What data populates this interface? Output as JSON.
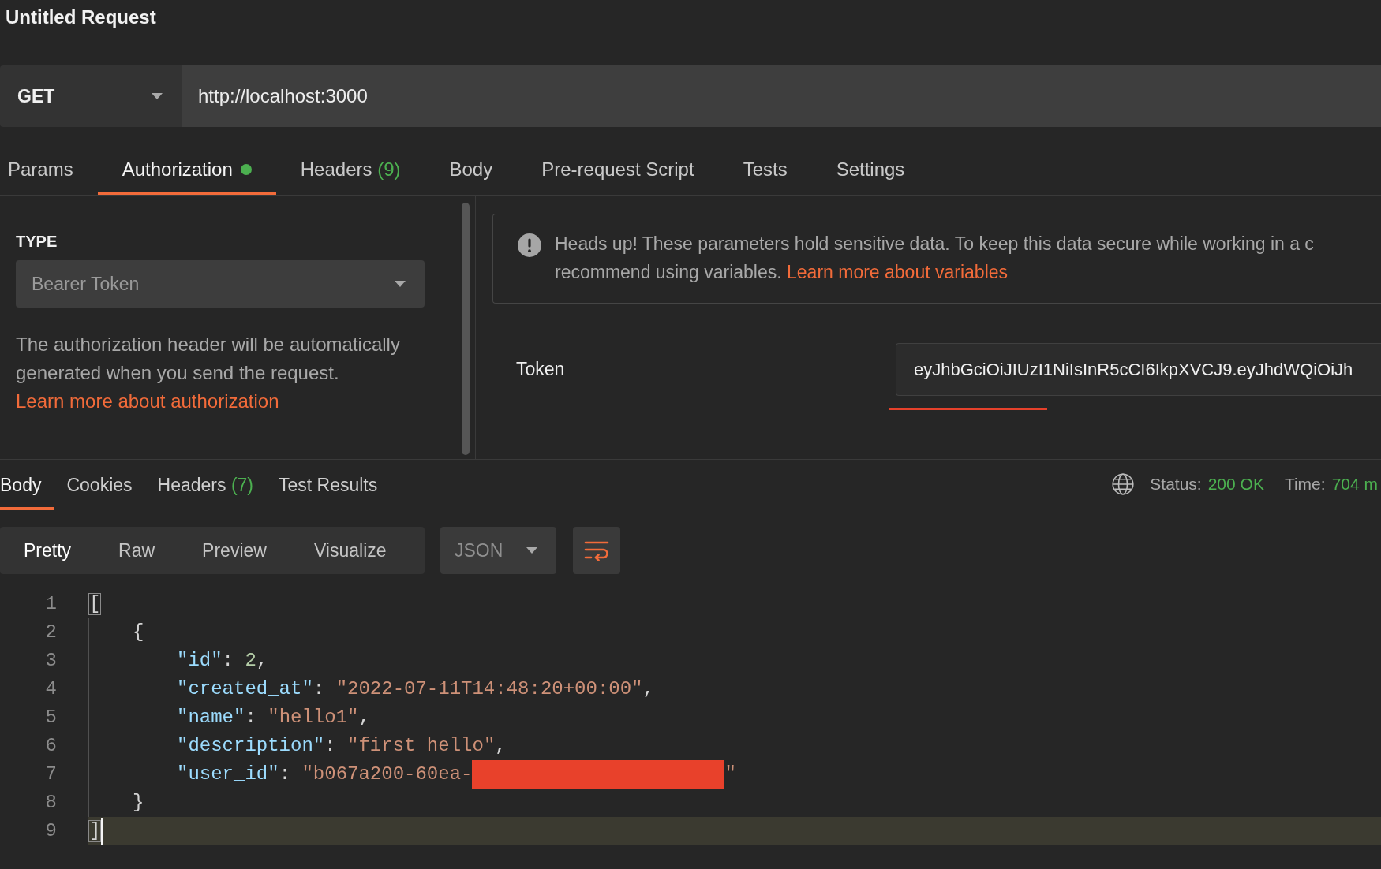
{
  "title": "Untitled Request",
  "request": {
    "method": "GET",
    "url": "http://localhost:3000"
  },
  "request_tabs": [
    {
      "label": "Params",
      "selected": false,
      "indicator": false
    },
    {
      "label": "Authorization",
      "selected": true,
      "indicator": true
    },
    {
      "label": "Headers",
      "count": "(9)",
      "selected": false,
      "indicator": false
    },
    {
      "label": "Body",
      "selected": false,
      "indicator": false
    },
    {
      "label": "Pre-request Script",
      "selected": false,
      "indicator": false
    },
    {
      "label": "Tests",
      "selected": false,
      "indicator": false
    },
    {
      "label": "Settings",
      "selected": false,
      "indicator": false
    }
  ],
  "auth": {
    "type_label": "TYPE",
    "type_value": "Bearer Token",
    "description": "The authorization header will be automatically generated when you send the request.",
    "link": "Learn more about authorization",
    "notice": {
      "lines": [
        "Heads up! These parameters hold sensitive data. To keep this data secure while working in a c",
        "recommend using variables."
      ],
      "link": "Learn more about variables"
    },
    "token": {
      "label": "Token",
      "value": "eyJhbGciOiJIUzI1NiIsInR5cCI6IkpXVCJ9.eyJhdWQiOiJh"
    }
  },
  "response_tabs": [
    {
      "label": "Body",
      "selected": true
    },
    {
      "label": "Cookies",
      "selected": false
    },
    {
      "label": "Headers",
      "count": "(7)",
      "selected": false
    },
    {
      "label": "Test Results",
      "selected": false
    }
  ],
  "status": {
    "label": "Status:",
    "value": "200 OK"
  },
  "time": {
    "label": "Time:",
    "value": "704 m"
  },
  "view_modes": [
    {
      "label": "Pretty",
      "selected": true
    },
    {
      "label": "Raw",
      "selected": false
    },
    {
      "label": "Preview",
      "selected": false
    },
    {
      "label": "Visualize",
      "selected": false
    }
  ],
  "format": "JSON",
  "wrap": {
    "on": true
  },
  "code": {
    "lines": [
      {
        "number": "1",
        "active": false,
        "tokens": [
          {
            "kind": "bracket_match",
            "text": "["
          }
        ],
        "children": [
          {
            "number": "2",
            "active": false,
            "tokens": [
              {
                "kind": "punct",
                "text": "{"
              }
            ],
            "children": [
              {
                "number": "3",
                "active": false,
                "tokens": [
                  {
                    "kind": "key",
                    "text": "\"id\""
                  },
                  {
                    "kind": "punct",
                    "text": ": "
                  },
                  {
                    "kind": "number",
                    "text": "2"
                  },
                  {
                    "kind": "punct",
                    "text": ","
                  }
                ]
              },
              {
                "number": "4",
                "active": false,
                "tokens": [
                  {
                    "kind": "key",
                    "text": "\"created_at\""
                  },
                  {
                    "kind": "punct",
                    "text": ": "
                  },
                  {
                    "kind": "string",
                    "text": "\"2022-07-11T14:48:20+00:00\""
                  },
                  {
                    "kind": "punct",
                    "text": ","
                  }
                ]
              },
              {
                "number": "5",
                "active": false,
                "tokens": [
                  {
                    "kind": "key",
                    "text": "\"name\""
                  },
                  {
                    "kind": "punct",
                    "text": ": "
                  },
                  {
                    "kind": "string",
                    "text": "\"hello1\""
                  },
                  {
                    "kind": "punct",
                    "text": ","
                  }
                ]
              },
              {
                "number": "6",
                "active": false,
                "tokens": [
                  {
                    "kind": "key",
                    "text": "\"description\""
                  },
                  {
                    "kind": "punct",
                    "text": ": "
                  },
                  {
                    "kind": "string",
                    "text": "\"first hello\""
                  },
                  {
                    "kind": "punct",
                    "text": ","
                  }
                ]
              },
              {
                "number": "7",
                "active": false,
                "tokens": [
                  {
                    "kind": "key",
                    "text": "\"user_id\""
                  },
                  {
                    "kind": "punct",
                    "text": ": "
                  },
                  {
                    "kind": "string",
                    "text": "\"b067a200-60ea-"
                  },
                  {
                    "kind": "redaction"
                  },
                  {
                    "kind": "string",
                    "text": "\""
                  }
                ]
              }
            ]
          },
          {
            "number": "8",
            "active": false,
            "tokens": [
              {
                "kind": "punct",
                "text": "}"
              }
            ]
          }
        ]
      },
      {
        "number": "9",
        "active": true,
        "tokens": [
          {
            "kind": "bracket_match",
            "text": "]"
          }
        ]
      }
    ]
  }
}
